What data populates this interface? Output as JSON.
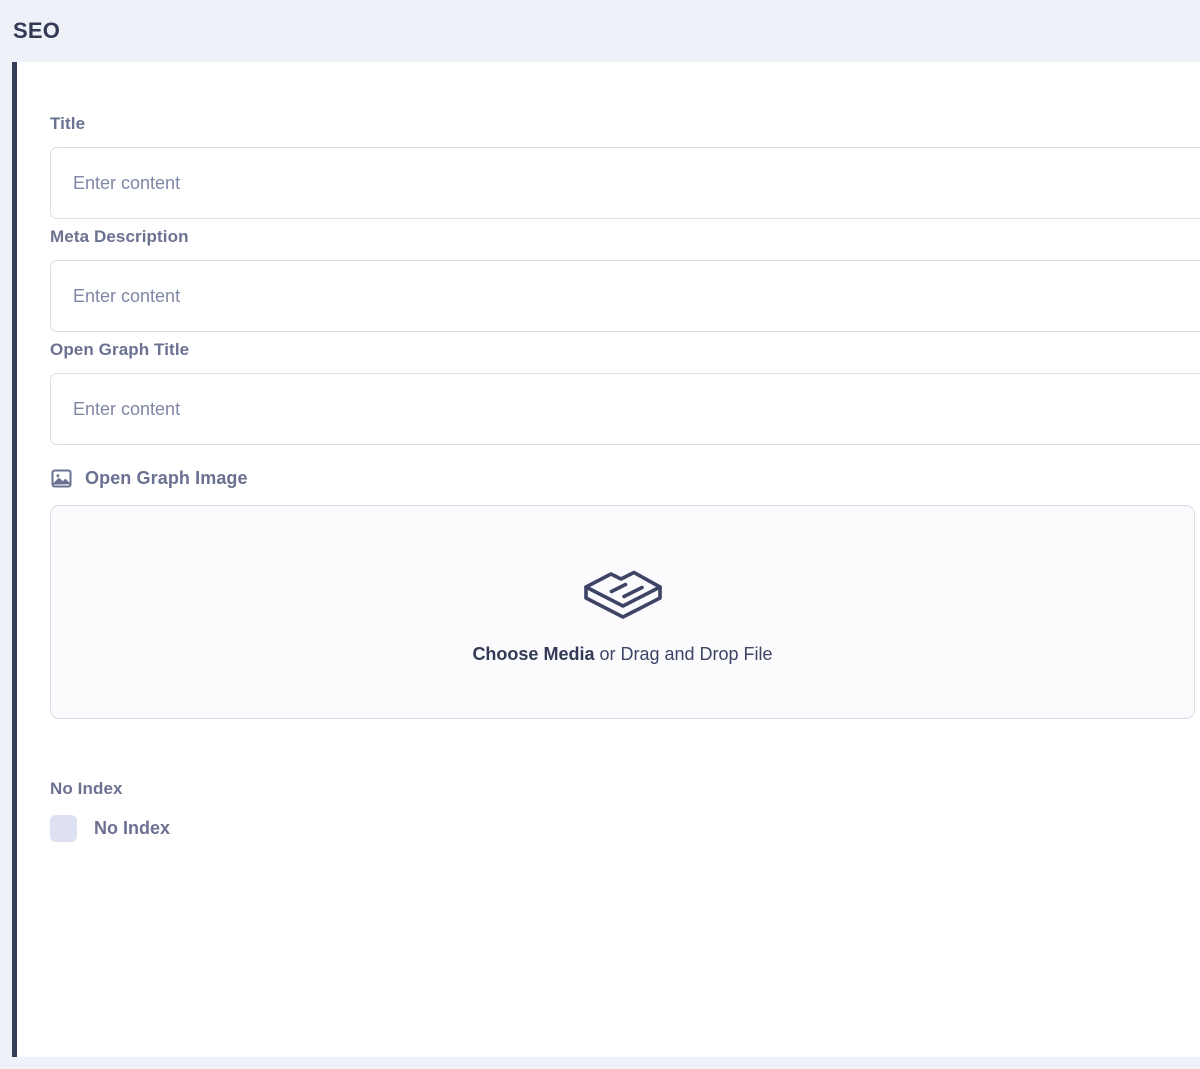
{
  "header": {
    "title": "SEO"
  },
  "form": {
    "fields": [
      {
        "label": "Title",
        "placeholder": "Enter content",
        "value": ""
      },
      {
        "label": "Meta Description",
        "placeholder": "Enter content",
        "value": ""
      },
      {
        "label": "Open Graph Title",
        "placeholder": "Enter content",
        "value": ""
      }
    ],
    "open_graph_image": {
      "label": "Open Graph Image",
      "icon": "image-icon",
      "dropzone": {
        "icon": "media-box-icon",
        "action_label": "Choose Media",
        "hint_text": " or Drag and Drop File"
      }
    },
    "no_index": {
      "section_label": "No Index",
      "checkbox_label": "No Index",
      "checked": false
    }
  },
  "colors": {
    "page_background": "#eef1f8",
    "panel_background": "#ffffff",
    "accent_bar": "#353c5a",
    "label_text": "#6b7190",
    "title_text": "#333a56",
    "input_border": "#dedde9",
    "placeholder_text": "#7f86a6",
    "dropzone_background": "#fbfafd",
    "checkbox_fill": "#dde1f2"
  }
}
